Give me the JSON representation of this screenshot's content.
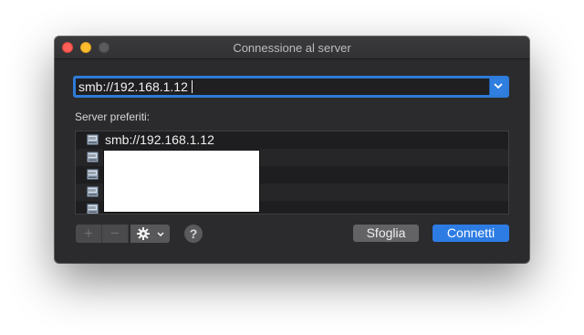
{
  "window": {
    "title": "Connessione al server"
  },
  "address": {
    "value": "smb://192.168.1.12"
  },
  "favorites": {
    "label": "Server preferiti:",
    "items": [
      {
        "label": "smb://192.168.1.12"
      },
      {
        "label": ""
      },
      {
        "label": ""
      },
      {
        "label": ""
      },
      {
        "label": ""
      }
    ]
  },
  "toolbar": {
    "add_label": "+",
    "remove_label": "−",
    "help_label": "?",
    "browse_label": "Sfoglia",
    "connect_label": "Connetti"
  },
  "icons": {
    "close": "close-dot",
    "minimize": "minimize-dot",
    "zoom": "zoom-dot",
    "dropdown": "chevron-down-icon",
    "server": "server-icon",
    "gear": "gear-icon"
  },
  "colors": {
    "accent": "#2d7ce4",
    "window_bg": "#2b2b2d",
    "focus_ring": "#2e7bd8"
  }
}
